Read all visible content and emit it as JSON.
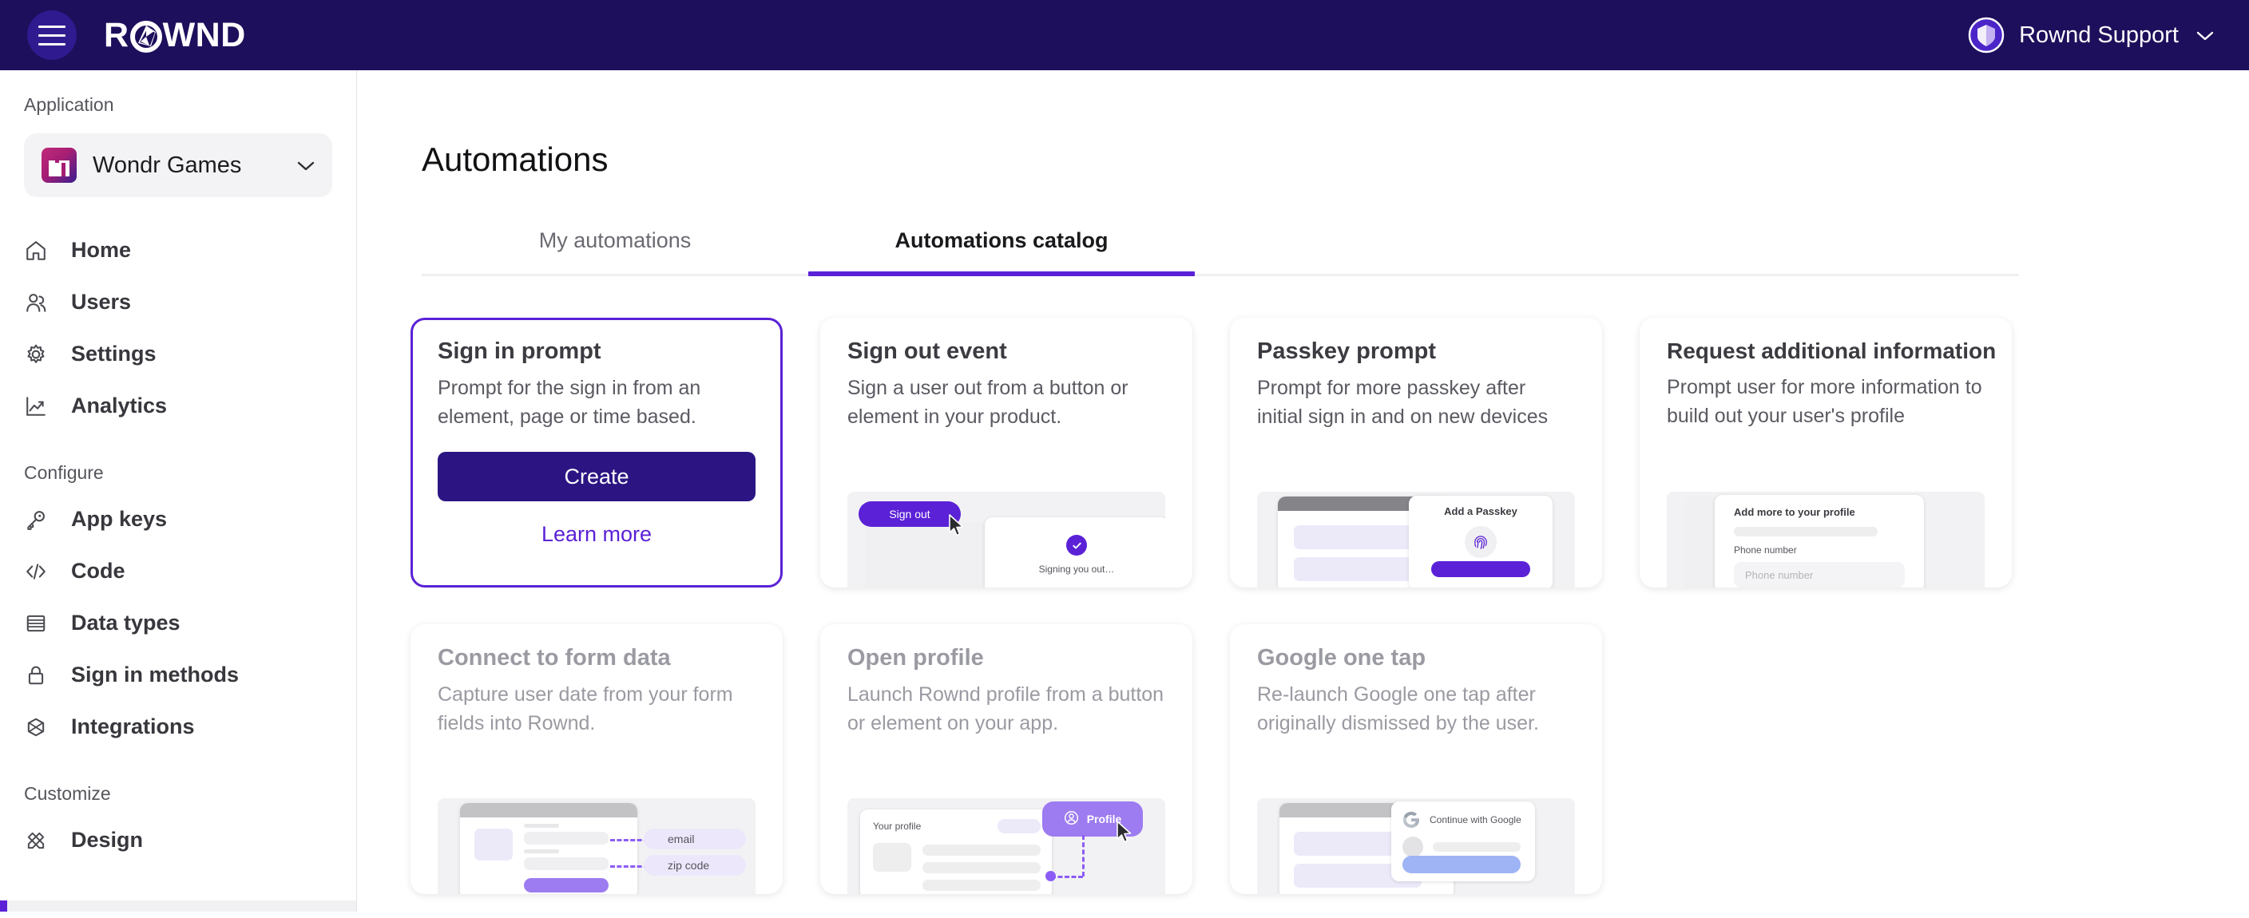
{
  "topbar": {
    "menu_icon": "hamburger-menu-icon",
    "brand": "ROWND",
    "user_name": "Rownd Support",
    "avatar_icon": "shield-avatar-icon",
    "chevron_icon": "chevron-down-icon"
  },
  "sidebar": {
    "application_label": "Application",
    "app_selector": {
      "name": "Wondr Games",
      "logo_icon": "wondr-games-logo-icon",
      "chevron_icon": "chevron-down-icon"
    },
    "primary_items": [
      {
        "label": "Home",
        "icon": "home-icon"
      },
      {
        "label": "Users",
        "icon": "users-icon"
      },
      {
        "label": "Settings",
        "icon": "gear-icon"
      },
      {
        "label": "Analytics",
        "icon": "chart-line-icon"
      }
    ],
    "configure_label": "Configure",
    "configure_items": [
      {
        "label": "App keys",
        "icon": "key-icon"
      },
      {
        "label": "Code",
        "icon": "code-brackets-icon"
      },
      {
        "label": "Data types",
        "icon": "table-rows-icon"
      },
      {
        "label": "Sign in methods",
        "icon": "lock-icon"
      },
      {
        "label": "Integrations",
        "icon": "hexagon-x-icon"
      }
    ],
    "customize_label": "Customize",
    "customize_items": [
      {
        "label": "Design",
        "icon": "paint-brushes-icon"
      }
    ]
  },
  "main": {
    "page_title": "Automations",
    "tabs": [
      {
        "label": "My automations",
        "active": false
      },
      {
        "label": "Automations catalog",
        "active": true
      }
    ],
    "cards": [
      {
        "title": "Sign in prompt",
        "description": "Prompt for the sign in from an element, page or time based.",
        "state": "selected",
        "create_label": "Create",
        "learn_more_label": "Learn more"
      },
      {
        "title": "Sign out event",
        "description": "Sign a user out from a button or element in your product.",
        "state": "enabled",
        "illustration": {
          "button_label": "Sign out",
          "status_text": "Signing you out…",
          "check_icon": "check-circle-icon",
          "cursor_icon": "mouse-cursor-icon"
        }
      },
      {
        "title": "Passkey prompt",
        "description": "Prompt for more passkey after initial sign in and on new devices",
        "state": "enabled",
        "illustration": {
          "dialog_title": "Add a Passkey",
          "fingerprint_icon": "fingerprint-icon"
        }
      },
      {
        "title": "Request additional information",
        "description": "Prompt user for more information to build out your user's profile",
        "state": "enabled",
        "illustration": {
          "dialog_title": "Add more to your profile",
          "field_label": "Phone number",
          "field_placeholder": "Phone number"
        }
      },
      {
        "title": "Connect to form data",
        "description": "Capture user date from your form fields into Rownd.",
        "state": "disabled",
        "illustration": {
          "tag_1": "email",
          "tag_2": "zip code"
        }
      },
      {
        "title": "Open profile",
        "description": "Launch Rownd profile from a button or element on your app.",
        "state": "disabled",
        "illustration": {
          "panel_title": "Your profile",
          "button_label": "Profile",
          "person_icon": "person-circle-icon",
          "cursor_icon": "mouse-cursor-icon"
        }
      },
      {
        "title": "Google one tap",
        "description": "Re-launch Google one tap after originally dismissed by the user.",
        "state": "disabled",
        "illustration": {
          "prompt_text": "Continue with Google",
          "google_icon": "google-g-icon"
        }
      }
    ]
  },
  "colors": {
    "brand_dark": "#1e0f5c",
    "accent_purple": "#5b21d6",
    "button_indigo": "#2c1583",
    "light_purple": "#8b5cf6"
  }
}
